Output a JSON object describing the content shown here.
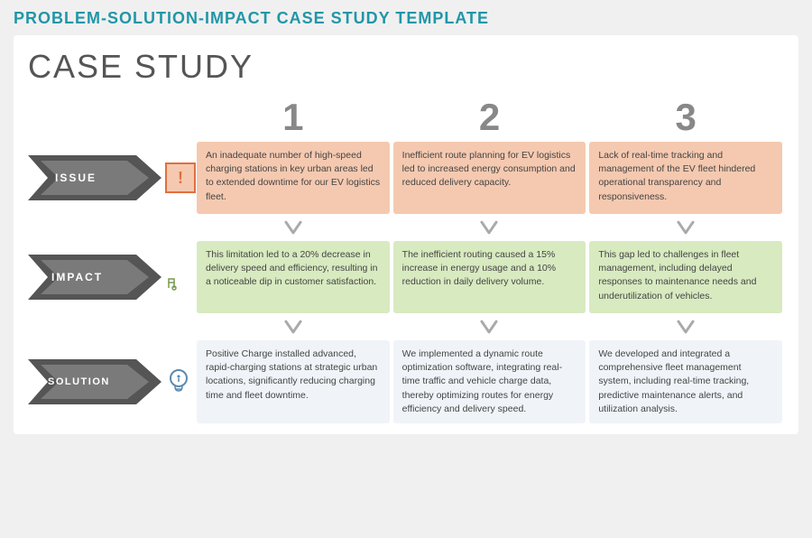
{
  "page": {
    "title": "PROBLEM-SOLUTION-IMPACT CASE STUDY TEMPLATE",
    "heading": "CASE STUDY"
  },
  "columns": [
    {
      "number": "1"
    },
    {
      "number": "2"
    },
    {
      "number": "3"
    }
  ],
  "rows": {
    "issue": {
      "label": "ISSUE",
      "cells": [
        "An inadequate number of high-speed charging stations in key urban areas led to extended downtime for our EV logistics fleet.",
        "Inefficient route planning for EV logistics led to increased energy consumption and reduced delivery capacity.",
        "Lack of real-time tracking and management of the EV fleet hindered operational transparency and responsiveness."
      ]
    },
    "impact": {
      "label": "IMPACT",
      "cells": [
        "This limitation led to a 20% decrease in delivery speed and efficiency, resulting in a noticeable dip in customer satisfaction.",
        "The inefficient routing caused a 15% increase in energy usage and a 10% reduction in daily delivery volume.",
        "This gap led to challenges in fleet management, including delayed responses to maintenance needs and underutilization of vehicles."
      ]
    },
    "solution": {
      "label": "SOLUTION",
      "cells": [
        "Positive Charge installed advanced, rapid-charging stations at strategic urban locations, significantly reducing charging time and fleet downtime.",
        "We implemented a dynamic route optimization software, integrating real-time traffic and vehicle charge data, thereby optimizing routes for energy efficiency and delivery speed.",
        "We developed and integrated a comprehensive fleet management system, including real-time tracking, predictive maintenance alerts, and utilization analysis."
      ]
    }
  }
}
